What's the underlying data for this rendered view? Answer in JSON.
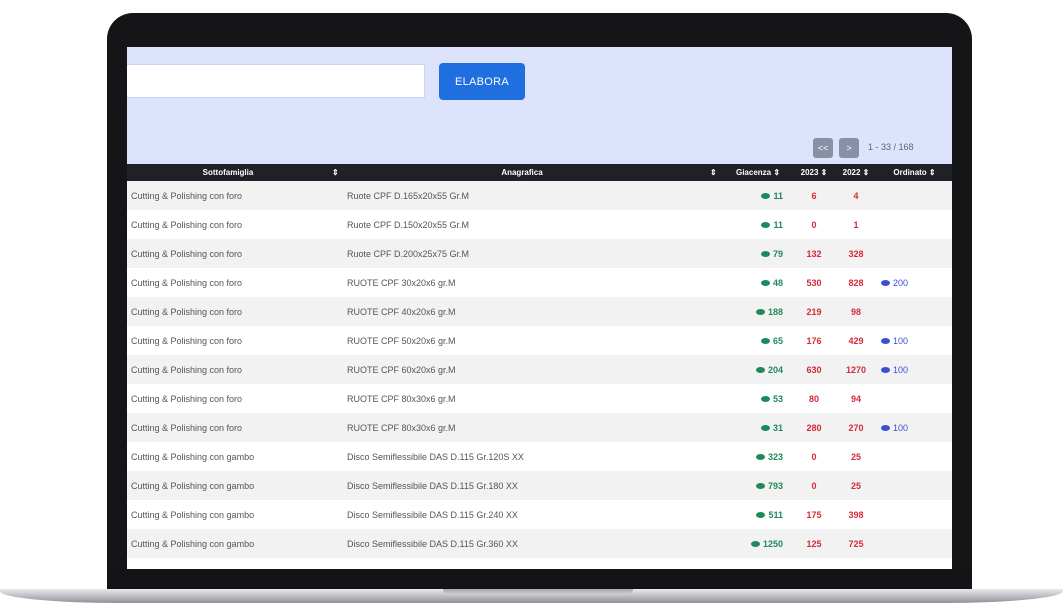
{
  "search": {
    "placeholder": "",
    "button_label": "ELABORA"
  },
  "pager": {
    "prev": "<<",
    "next": ">",
    "text": "1 - 33 / 168"
  },
  "table": {
    "headers": {
      "family": "Sottofamiglia",
      "sort1": "⇕",
      "description": "Anagrafica",
      "sort2": "⇕",
      "stock": "Giacenza ⇕",
      "year1": "2023 ⇕",
      "year2": "2022 ⇕",
      "orders": "Ordinato ⇕"
    },
    "rows": [
      {
        "family": "Cutting & Polishing con foro",
        "description": "Ruote CPF D.165x20x55 Gr.M",
        "stock": "11",
        "year1": "6",
        "year2": "4",
        "orders": ""
      },
      {
        "family": "Cutting & Polishing con foro",
        "description": "Ruote CPF D.150x20x55 Gr.M",
        "stock": "11",
        "year1": "0",
        "year2": "1",
        "orders": ""
      },
      {
        "family": "Cutting & Polishing con foro",
        "description": "Ruote CPF D.200x25x75 Gr.M",
        "stock": "79",
        "year1": "132",
        "year2": "328",
        "orders": ""
      },
      {
        "family": "Cutting & Polishing con foro",
        "description": "RUOTE CPF 30x20x6 gr.M",
        "stock": "48",
        "year1": "530",
        "year2": "828",
        "orders": "200"
      },
      {
        "family": "Cutting & Polishing con foro",
        "description": "RUOTE CPF 40x20x6 gr.M",
        "stock": "188",
        "year1": "219",
        "year2": "98",
        "orders": ""
      },
      {
        "family": "Cutting & Polishing con foro",
        "description": "RUOTE CPF 50x20x6 gr.M",
        "stock": "65",
        "year1": "176",
        "year2": "429",
        "orders": "100"
      },
      {
        "family": "Cutting & Polishing con foro",
        "description": "RUOTE CPF 60x20x6 gr.M",
        "stock": "204",
        "year1": "630",
        "year2": "1270",
        "orders": "100"
      },
      {
        "family": "Cutting & Polishing con foro",
        "description": "RUOTE CPF 80x30x6 gr.M",
        "stock": "53",
        "year1": "80",
        "year2": "94",
        "orders": ""
      },
      {
        "family": "Cutting & Polishing con foro",
        "description": "RUOTE CPF 80x30x6 gr.M",
        "stock": "31",
        "year1": "280",
        "year2": "270",
        "orders": "100"
      },
      {
        "family": "Cutting & Polishing con gambo",
        "description": "Disco Semiflessibile DAS D.115 Gr.120S XX",
        "stock": "323",
        "year1": "0",
        "year2": "25",
        "orders": ""
      },
      {
        "family": "Cutting & Polishing con gambo",
        "description": "Disco Semiflessibile DAS D.115 Gr.180 XX",
        "stock": "793",
        "year1": "0",
        "year2": "25",
        "orders": ""
      },
      {
        "family": "Cutting & Polishing con gambo",
        "description": "Disco Semiflessibile DAS D.115 Gr.240 XX",
        "stock": "511",
        "year1": "175",
        "year2": "398",
        "orders": ""
      },
      {
        "family": "Cutting & Polishing con gambo",
        "description": "Disco Semiflessibile DAS D.115 Gr.360 XX",
        "stock": "1250",
        "year1": "125",
        "year2": "725",
        "orders": ""
      }
    ]
  },
  "colors": {
    "accent": "#1f6fe0",
    "header_bg": "#dde3fb",
    "stock": "#1e8a5a",
    "sales": "#d42a3a",
    "orders": "#3a4fd6"
  }
}
